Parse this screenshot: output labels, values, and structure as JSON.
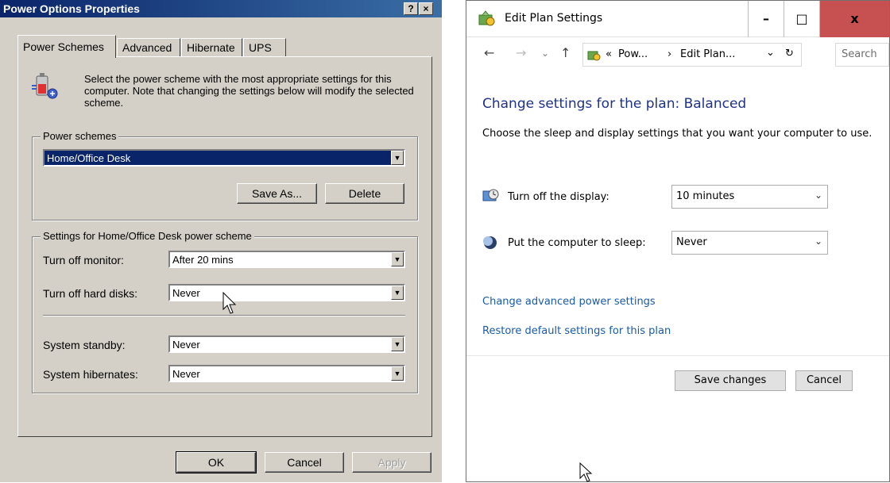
{
  "xp_dialog": {
    "title": "Power Options Properties",
    "help_button": "?",
    "close_button": "×",
    "tabs": [
      {
        "label": "Power Schemes"
      },
      {
        "label": "Advanced"
      },
      {
        "label": "Hibernate"
      },
      {
        "label": "UPS"
      }
    ],
    "description": "Select the power scheme with the most appropriate settings for this computer. Note that changing the settings below will modify the selected scheme.",
    "schemes_group": {
      "legend": "Power schemes",
      "selected_value": "Home/Office Desk",
      "save_as_label": "Save As...",
      "delete_label": "Delete"
    },
    "settings_group": {
      "legend": "Settings for Home/Office Desk power scheme",
      "rows": [
        {
          "label": "Turn off monitor:",
          "value": "After 20 mins"
        },
        {
          "label": "Turn off hard disks:",
          "value": "Never"
        },
        {
          "label": "System standby:",
          "value": "Never"
        },
        {
          "label": "System hibernates:",
          "value": "Never"
        }
      ]
    },
    "buttons": {
      "ok": "OK",
      "cancel": "Cancel",
      "apply": "Apply"
    }
  },
  "w10_window": {
    "title": "Edit Plan Settings",
    "caption": {
      "minimize": "–",
      "maximize": "□",
      "close": "x"
    },
    "nav": {
      "back": "←",
      "forward": "→",
      "recent": "⌄",
      "up": "↑"
    },
    "address": {
      "prefix": "«",
      "crumb1": "Pow...",
      "sep": "›",
      "crumb2": "Edit Plan...",
      "dropdown": "⌄",
      "refresh": "↻"
    },
    "search_placeholder": "Search",
    "heading": "Change settings for the plan: Balanced",
    "description": "Choose the sleep and display settings that you want your computer to use.",
    "rows": [
      {
        "label": "Turn off the display:",
        "value": "10 minutes"
      },
      {
        "label": "Put the computer to sleep:",
        "value": "Never"
      }
    ],
    "links": {
      "advanced": "Change advanced power settings",
      "restore": "Restore default settings for this plan"
    },
    "buttons": {
      "save": "Save changes",
      "cancel": "Cancel"
    }
  }
}
